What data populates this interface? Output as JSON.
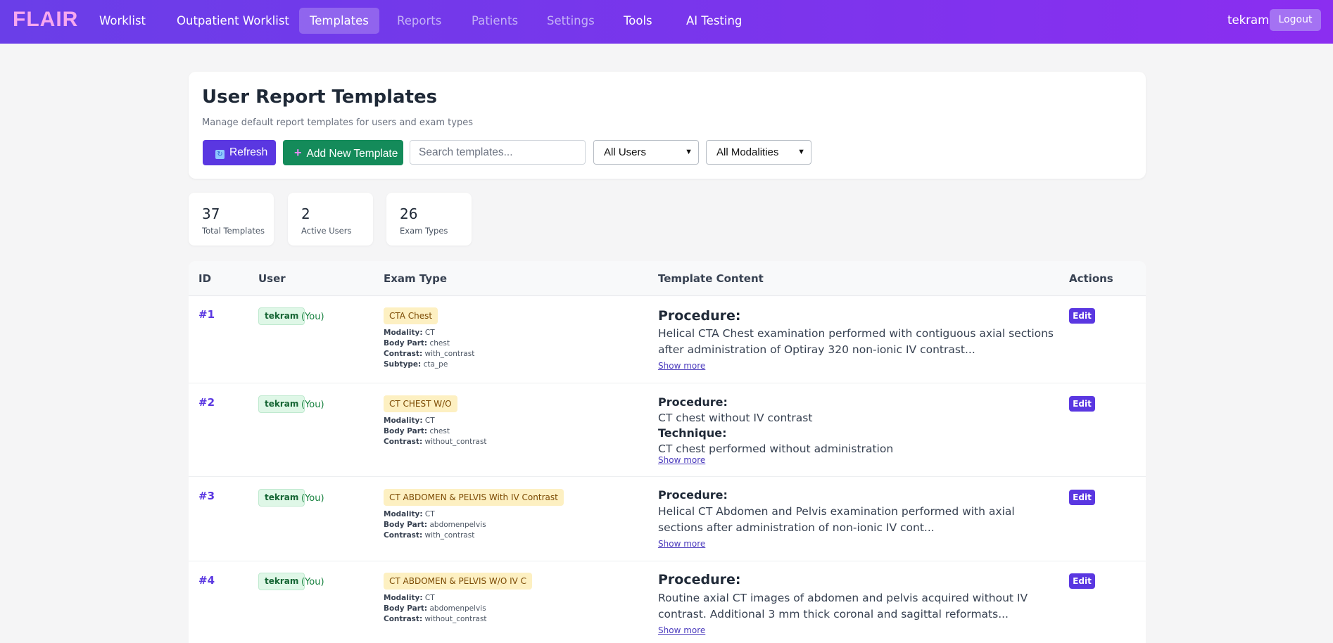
{
  "nav": {
    "logo": "FLAIR",
    "items": [
      {
        "label": "Worklist"
      },
      {
        "label": "Outpatient Worklist"
      },
      {
        "label": "Templates"
      },
      {
        "label": "Reports"
      },
      {
        "label": "Patients"
      },
      {
        "label": "Settings"
      },
      {
        "label": "Tools"
      },
      {
        "label": "AI Testing"
      }
    ],
    "active": "Templates",
    "username": "tekram",
    "logout_label": "Logout"
  },
  "header": {
    "title": "User Report Templates",
    "subtitle": "Manage default report templates for users and exam types",
    "refresh_label": "Refresh",
    "add_label": "Add New Template",
    "search_placeholder": "Search templates...",
    "user_filter": "All Users",
    "modality_filter": "All Modalities"
  },
  "stats": [
    {
      "value": "37",
      "label": "Total Templates"
    },
    {
      "value": "2",
      "label": "Active Users"
    },
    {
      "value": "26",
      "label": "Exam Types"
    }
  ],
  "table": {
    "headers": [
      "ID",
      "User",
      "Exam Type",
      "Template Content",
      "Actions"
    ],
    "rows": [
      {
        "id": "#1",
        "user": "tekram",
        "you": "(You)",
        "exam": "CTA Chest",
        "modality": "CT",
        "body_part": "chest",
        "contrast": "with_contrast",
        "subtype": "cta_pe",
        "proc_title": "Procedure:",
        "proc_text": "Helical CTA Chest examination performed with contiguous axial sections after administration of Optiray 320 non-ionic IV contrast...",
        "show_more": "Show more",
        "edit": "Edit"
      },
      {
        "id": "#2",
        "user": "tekram",
        "you": "(You)",
        "exam": "CT CHEST W/O",
        "modality": "CT",
        "body_part": "chest",
        "contrast": "without_contrast",
        "proc_title": "Procedure:",
        "proc_text": "CT chest without IV contrast",
        "tech_title": "Technique:",
        "tech_text": "CT chest performed without administration",
        "show_more": "Show more",
        "edit": "Edit"
      },
      {
        "id": "#3",
        "user": "tekram",
        "you": "(You)",
        "exam": "CT ABDOMEN & PELVIS With IV Contrast",
        "modality": "CT",
        "body_part": "abdomenpelvis",
        "contrast": "with_contrast",
        "proc_title": "Procedure:",
        "proc_text": "Helical CT Abdomen and Pelvis examination performed with axial sections after administration of non-ionic IV cont...",
        "show_more": "Show more",
        "edit": "Edit"
      },
      {
        "id": "#4",
        "user": "tekram",
        "you": "(You)",
        "exam": "CT ABDOMEN & PELVIS W/O IV C",
        "modality": "CT",
        "body_part": "abdomenpelvis",
        "contrast": "without_contrast",
        "proc_title": "Procedure:",
        "proc_text": "Routine axial CT images of abdomen and pelvis acquired without IV contrast. Additional 3 mm thick coronal and sagittal reformats...",
        "show_more": "Show more",
        "edit": "Edit"
      }
    ],
    "meta_labels": {
      "modality": "Modality:",
      "body_part": "Body Part:",
      "contrast": "Contrast:",
      "subtype": "Subtype:"
    }
  },
  "colors": {
    "nav_start": "#6a3ee8",
    "nav_end": "#8b2ef0",
    "primary": "#5a37e1",
    "success": "#148b5a",
    "logo": "#f7a8ef"
  }
}
